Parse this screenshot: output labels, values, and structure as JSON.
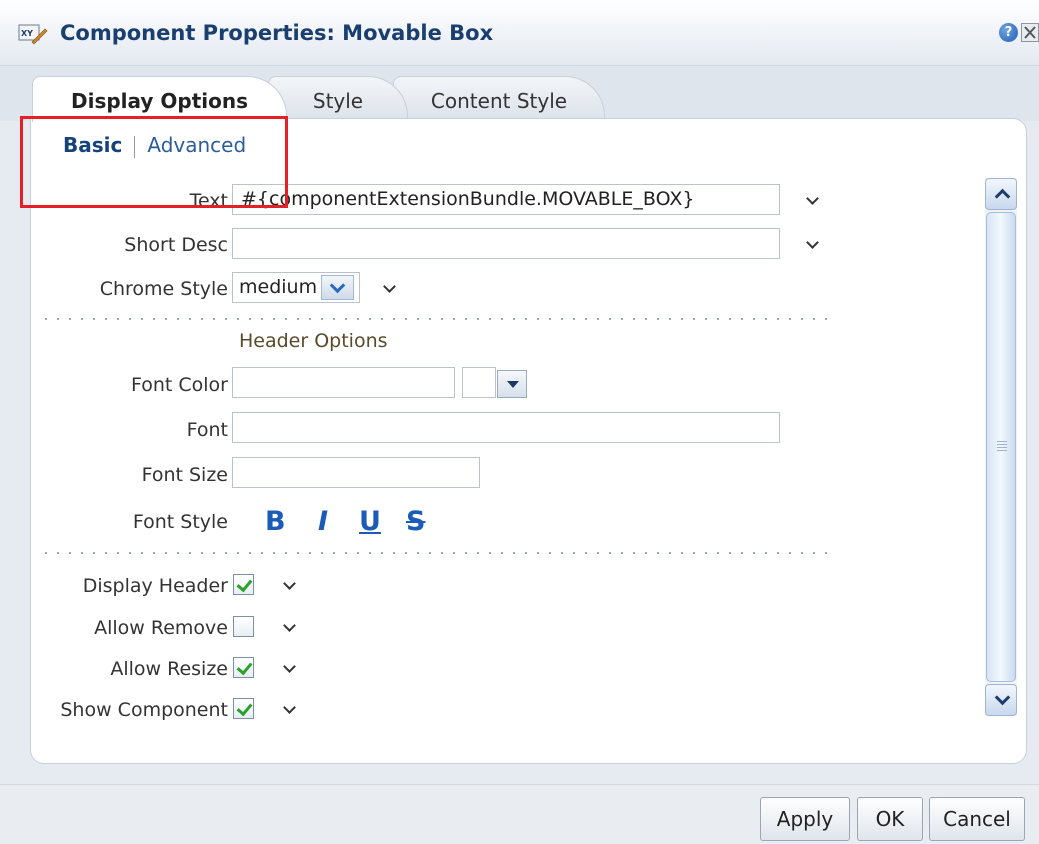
{
  "dialog": {
    "title": "Component Properties: Movable Box",
    "title_icon": "xy-edit-icon",
    "help_icon": "help-icon",
    "close_icon": "close-icon"
  },
  "tabs": [
    {
      "label": "Display Options",
      "selected": true
    },
    {
      "label": "Style",
      "selected": false
    },
    {
      "label": "Content Style",
      "selected": false
    }
  ],
  "subnav": {
    "basic": "Basic",
    "advanced": "Advanced",
    "selected": "Basic"
  },
  "form": {
    "text": {
      "label": "Text",
      "value": "#{componentExtensionBundle.MOVABLE_BOX}"
    },
    "short_desc": {
      "label": "Short Desc",
      "value": ""
    },
    "chrome_style": {
      "label": "Chrome Style",
      "value": "medium"
    },
    "header_options": "Header Options",
    "font_color": {
      "label": "Font Color",
      "value": ""
    },
    "font": {
      "label": "Font",
      "value": ""
    },
    "font_size": {
      "label": "Font Size",
      "value": ""
    },
    "font_style": {
      "label": "Font Style",
      "bold": "B",
      "italic": "I",
      "underline": "U",
      "strike": "S"
    },
    "display_header": {
      "label": "Display Header",
      "checked": true
    },
    "allow_remove": {
      "label": "Allow Remove",
      "checked": false
    },
    "allow_resize": {
      "label": "Allow Resize",
      "checked": true
    },
    "show_component": {
      "label": "Show Component",
      "checked": true
    }
  },
  "buttons": {
    "apply": "Apply",
    "ok": "OK",
    "cancel": "Cancel"
  },
  "colors": {
    "title": "#1a3e6e",
    "accent_blue": "#1d5bb8",
    "highlight_red": "#e41f26",
    "check_green": "#2aa12a"
  }
}
